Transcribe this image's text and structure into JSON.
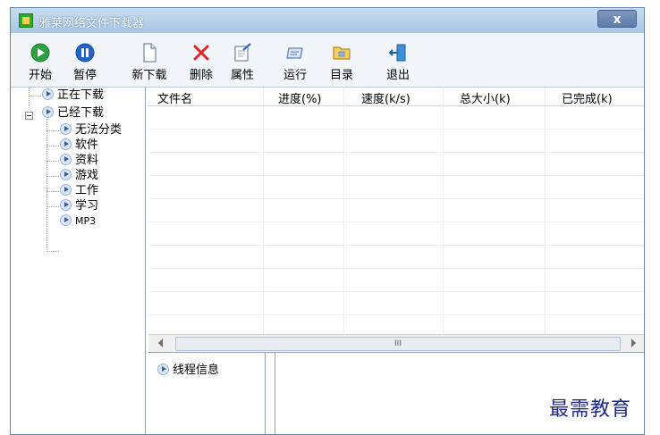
{
  "window": {
    "title": "雅莱网络文件下载器",
    "close_label": "x"
  },
  "toolbar": [
    {
      "label": "开始",
      "icon": "play-icon"
    },
    {
      "label": "暂停",
      "icon": "pause-icon"
    },
    {
      "label": "新下载",
      "icon": "new-file-icon"
    },
    {
      "label": "删除",
      "icon": "delete-icon"
    },
    {
      "label": "属性",
      "icon": "properties-icon"
    },
    {
      "label": "运行",
      "icon": "run-icon"
    },
    {
      "label": "目录",
      "icon": "folder-icon"
    },
    {
      "label": "退出",
      "icon": "exit-icon"
    }
  ],
  "tree": {
    "downloading": "正在下载",
    "downloaded": "已经下载",
    "categories": [
      "无法分类",
      "软件",
      "资料",
      "游戏",
      "工作",
      "学习",
      "MP3"
    ]
  },
  "table": {
    "columns": [
      "文件名",
      "进度(%)",
      "速度(k/s)",
      "总大小(k)",
      "已完成(k)"
    ]
  },
  "scrollbar": {
    "thumb_grip": "III"
  },
  "thread_panel": {
    "label": "线程信息"
  },
  "watermark": "最需教育",
  "colors": {
    "accent": "#5f88b6",
    "watermark": "#1f2b8a"
  }
}
